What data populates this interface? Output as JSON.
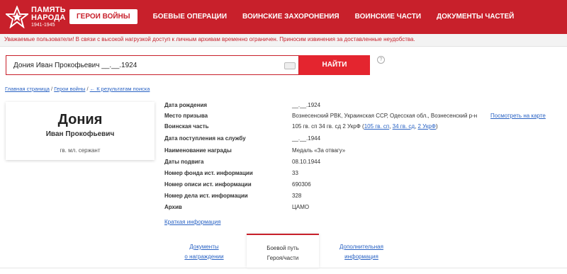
{
  "header": {
    "logo": {
      "line1": "ПАМЯТЬ",
      "line2": "НАРОДА",
      "line3": "1941-1945"
    },
    "nav": [
      {
        "label": "ГЕРОИ ВОЙНЫ",
        "active": true
      },
      {
        "label": "БОЕВЫЕ ОПЕРАЦИИ",
        "active": false
      },
      {
        "label": "ВОИНСКИЕ ЗАХОРОНЕНИЯ",
        "active": false
      },
      {
        "label": "ВОИНСКИЕ ЧАСТИ",
        "active": false
      },
      {
        "label": "ДОКУМЕНТЫ ЧАСТЕЙ",
        "active": false
      }
    ]
  },
  "notice": "Уважаемые пользователи! В связи с высокой нагрузкой доступ к личным архивам временно ограничен. Приносим извинения за доставленные неудобства.",
  "search": {
    "value": "Дония Иван Прокофьевич __.__.1924",
    "button": "НАЙТИ",
    "help": "?"
  },
  "breadcrumb": {
    "home": "Главная страница",
    "sep1": " / ",
    "heroes": "Герои войны",
    "sep2": " / ",
    "back": "← К результатам поиска"
  },
  "person": {
    "surname": "Дония",
    "name": "Иван Прокофьевич",
    "rank": "гв. мл. сержант"
  },
  "info": {
    "birth_label": "Дата рождения",
    "birth_value": "__.__.1924",
    "draft_label": "Место призыва",
    "draft_value": "Вознесенский РВК, Украинская ССР, Одесская обл., Вознесенский р-н",
    "map_link": "Посмотреть на карте",
    "unit_label": "Воинская часть",
    "unit_prefix": "105 гв. сп 34 гв. сд 2 УкрФ (",
    "unit_link1": "105 гв. сп",
    "unit_sep1": ", ",
    "unit_link2": "34 гв. сд",
    "unit_sep2": ", ",
    "unit_link3": "2 УкрФ",
    "unit_suffix": ")",
    "service_label": "Дата поступления на службу",
    "service_value": "__.__.1944",
    "award_label": "Наименование награды",
    "award_value": "Медаль «За отвагу»",
    "feat_label": "Даты подвига",
    "feat_value": "08.10.1944",
    "fond_label": "Номер фонда ист. информации",
    "fond_value": "33",
    "opis_label": "Номер описи ист. информации",
    "opis_value": "690306",
    "delo_label": "Номер дела ист. информации",
    "delo_value": "328",
    "archive_label": "Архив",
    "archive_value": "ЦАМО"
  },
  "brief_link": "Краткая информация",
  "tabs": [
    {
      "line1": "Документы",
      "line2": "о награждении",
      "active": false
    },
    {
      "line1": "Боевой путь",
      "line2": "Героя/части",
      "active": true
    },
    {
      "line1": "Дополнительная",
      "line2": "информация",
      "active": false
    }
  ],
  "colors": {
    "brand_red": "#c8202b",
    "button_red": "#e4252f",
    "link_blue": "#2a63c4"
  }
}
